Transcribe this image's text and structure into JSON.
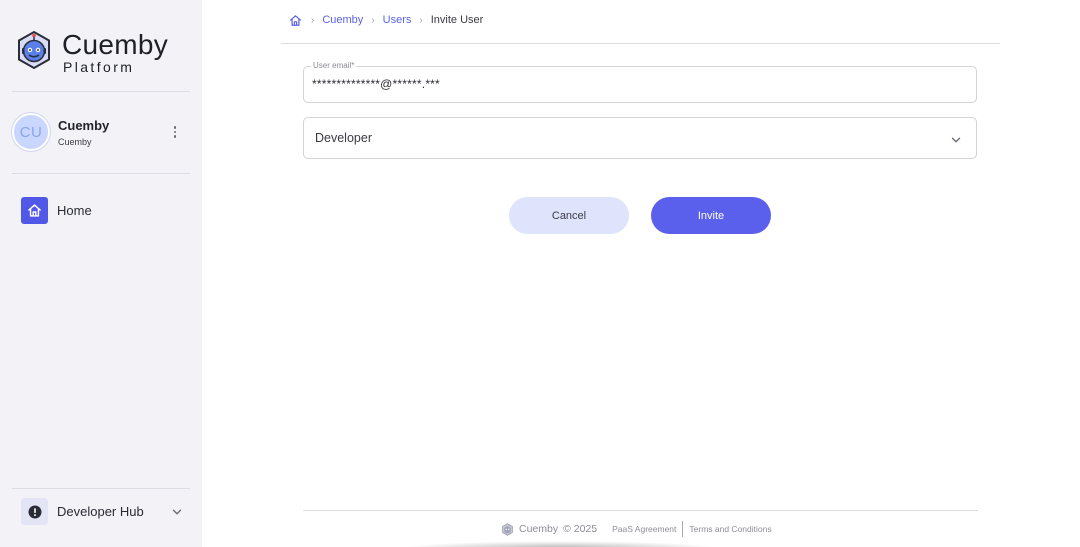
{
  "brand": {
    "name": "Cuemby",
    "subtitle": "Platform",
    "logo_icon": "cuemby-robot-logo-icon"
  },
  "user": {
    "initials": "CU",
    "name": "Cuemby",
    "org": "Cuemby",
    "menu_icon": "more-vertical-icon"
  },
  "nav": {
    "items": [
      {
        "label": "Home",
        "icon": "home-icon",
        "active": true
      }
    ]
  },
  "developer_hub": {
    "label": "Developer Hub",
    "icon": "alert-circle-icon",
    "chevron_icon": "chevron-down-icon"
  },
  "breadcrumb": {
    "home_icon": "home-icon",
    "items": [
      {
        "label": "Cuemby",
        "link": true
      },
      {
        "label": "Users",
        "link": true
      },
      {
        "label": "Invite User",
        "link": false
      }
    ]
  },
  "form": {
    "email": {
      "label": "User email*",
      "value": "**************@******.***"
    },
    "role": {
      "value": "Developer",
      "chevron_icon": "chevron-down-icon"
    },
    "cancel_label": "Cancel",
    "invite_label": "Invite"
  },
  "footer": {
    "brand": "Cuemby",
    "copyright": "© 2025",
    "links": [
      "PaaS Agreement",
      "Terms and Conditions"
    ]
  },
  "colors": {
    "accent": "#5a5fec",
    "accent_soft": "#dfe3fb",
    "sidebar_bg": "#f3f3f7",
    "nav_active_bg": "#5158e8",
    "link": "#5b63e6"
  }
}
